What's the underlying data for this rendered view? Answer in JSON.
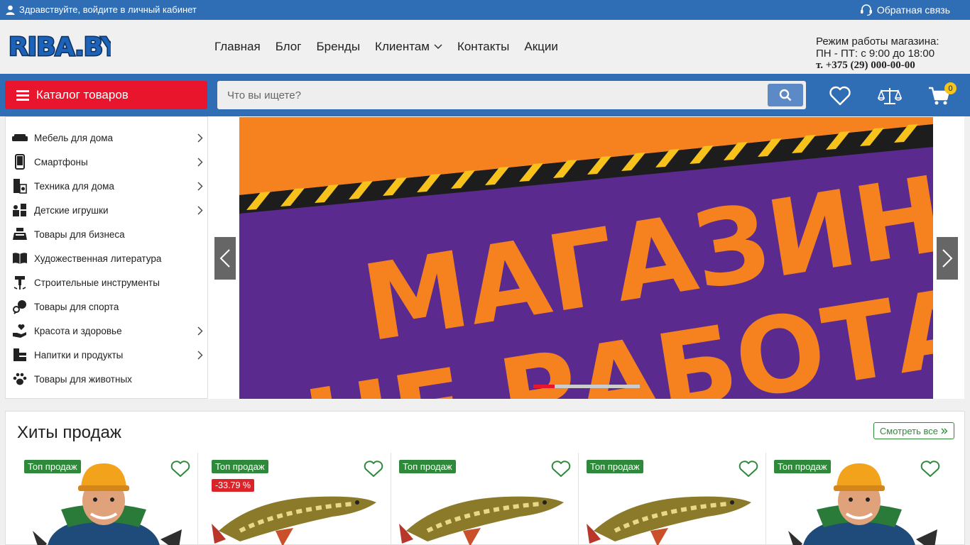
{
  "topbar": {
    "login_text": "Здравствуйте, войдите в личный кабинет",
    "feedback_text": "Обратная связь"
  },
  "header": {
    "logo_text": "RIBA.BY",
    "nav": [
      {
        "label": "Главная"
      },
      {
        "label": "Блог"
      },
      {
        "label": "Бренды"
      },
      {
        "label": "Клиентам"
      },
      {
        "label": "Контакты"
      },
      {
        "label": "Акции"
      }
    ],
    "hours_title": "Режим работы магазина:",
    "hours_value": "ПН - ПТ: с 9:00 до 18:00",
    "phone": "т. +375 (29) 000-00-00"
  },
  "toolbar": {
    "catalog_label": "Каталог товаров",
    "search_placeholder": "Что вы ищете?",
    "cart_count": "0"
  },
  "sidebar": {
    "items": [
      {
        "label": "Мебель для дома",
        "icon": "sofa-icon",
        "has_sub": true
      },
      {
        "label": "Смартфоны",
        "icon": "smartphone-icon",
        "has_sub": true
      },
      {
        "label": "Техника для дома",
        "icon": "appliance-icon",
        "has_sub": true
      },
      {
        "label": "Детские игрушки",
        "icon": "puzzle-icon",
        "has_sub": true
      },
      {
        "label": "Товары для бизнеса",
        "icon": "cash-register-icon",
        "has_sub": false
      },
      {
        "label": "Художественная литература",
        "icon": "book-icon",
        "has_sub": false
      },
      {
        "label": "Строительные инструменты",
        "icon": "drill-icon",
        "has_sub": false
      },
      {
        "label": "Товары для спорта",
        "icon": "sport-icon",
        "has_sub": false
      },
      {
        "label": "Красота и здоровье",
        "icon": "heart-hand-icon",
        "has_sub": true
      },
      {
        "label": "Напитки и продукты",
        "icon": "food-icon",
        "has_sub": true
      },
      {
        "label": "Товары для животных",
        "icon": "paw-icon",
        "has_sub": false
      }
    ]
  },
  "banner": {
    "line1": "МАГАЗИН",
    "line2": "НЕ РАБОТАЕТ",
    "slides": 5,
    "active_slide": 1
  },
  "hits": {
    "title": "Хиты продаж",
    "see_all": "Смотреть все",
    "products": [
      {
        "badge": "Топ продаж",
        "discount": "",
        "image": "fisherman-icon"
      },
      {
        "badge": "Топ продаж",
        "discount": "-33.79 %",
        "image": "pike-fish-icon"
      },
      {
        "badge": "Топ продаж",
        "discount": "",
        "image": "pike-fish-icon"
      },
      {
        "badge": "Топ продаж",
        "discount": "",
        "image": "pike-fish-icon"
      },
      {
        "badge": "Топ продаж",
        "discount": "",
        "image": "fisherman-icon"
      }
    ]
  },
  "colors": {
    "primary_blue": "#2f6db5",
    "catalog_red": "#e8152c",
    "badge_green": "#2e8a3a",
    "discount_red": "#d9252a",
    "banner_orange": "#f5821f",
    "banner_purple": "#5a2a8e"
  }
}
